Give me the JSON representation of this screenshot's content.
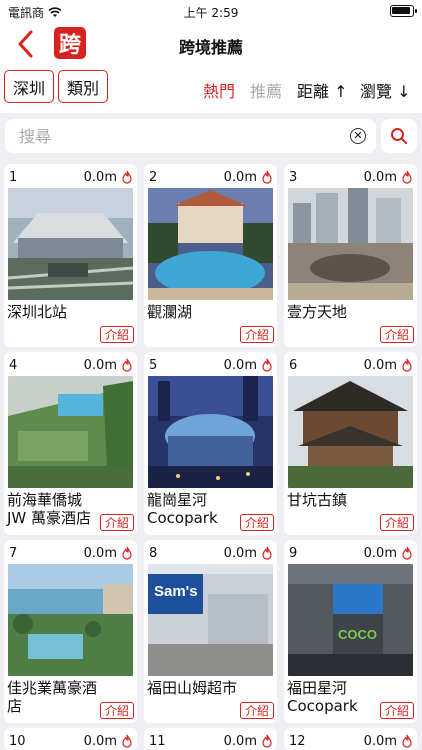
{
  "status": {
    "carrier": "電訊商",
    "time": "上午 2:59"
  },
  "nav": {
    "logo": "跨",
    "title": "跨境推薦"
  },
  "filters": {
    "region": "深圳",
    "category": "類別",
    "hot": "熱門",
    "recommend": "推薦",
    "distance": "距離 ↑",
    "views": "瀏覽 ↓"
  },
  "search": {
    "placeholder": "搜尋",
    "value": ""
  },
  "accent": "#d6231f",
  "places": [
    {
      "num": "1",
      "dist": "0.0m",
      "name": "深圳北站",
      "intro": "介紹"
    },
    {
      "num": "2",
      "dist": "0.0m",
      "name": "觀瀾湖",
      "intro": "介紹"
    },
    {
      "num": "3",
      "dist": "0.0m",
      "name": "壹方天地",
      "intro": "介紹"
    },
    {
      "num": "4",
      "dist": "0.0m",
      "name": "前海華僑城 JW 萬豪酒店",
      "intro": "介紹"
    },
    {
      "num": "5",
      "dist": "0.0m",
      "name": "龍崗星河 Cocopark",
      "intro": "介紹"
    },
    {
      "num": "6",
      "dist": "0.0m",
      "name": "甘坑古鎮",
      "intro": "介紹"
    },
    {
      "num": "7",
      "dist": "0.0m",
      "name": "佳兆業萬豪酒店",
      "intro": "介紹"
    },
    {
      "num": "8",
      "dist": "0.0m",
      "name": "福田山姆超市",
      "intro": "介紹"
    },
    {
      "num": "9",
      "dist": "0.0m",
      "name": "福田星河 Cocopark",
      "intro": "介紹"
    },
    {
      "num": "10",
      "dist": "0.0m"
    },
    {
      "num": "11",
      "dist": "0.0m"
    },
    {
      "num": "12",
      "dist": "0.0m"
    }
  ],
  "photo_signs": {
    "p8": "Sam's",
    "p9": "COCO"
  }
}
